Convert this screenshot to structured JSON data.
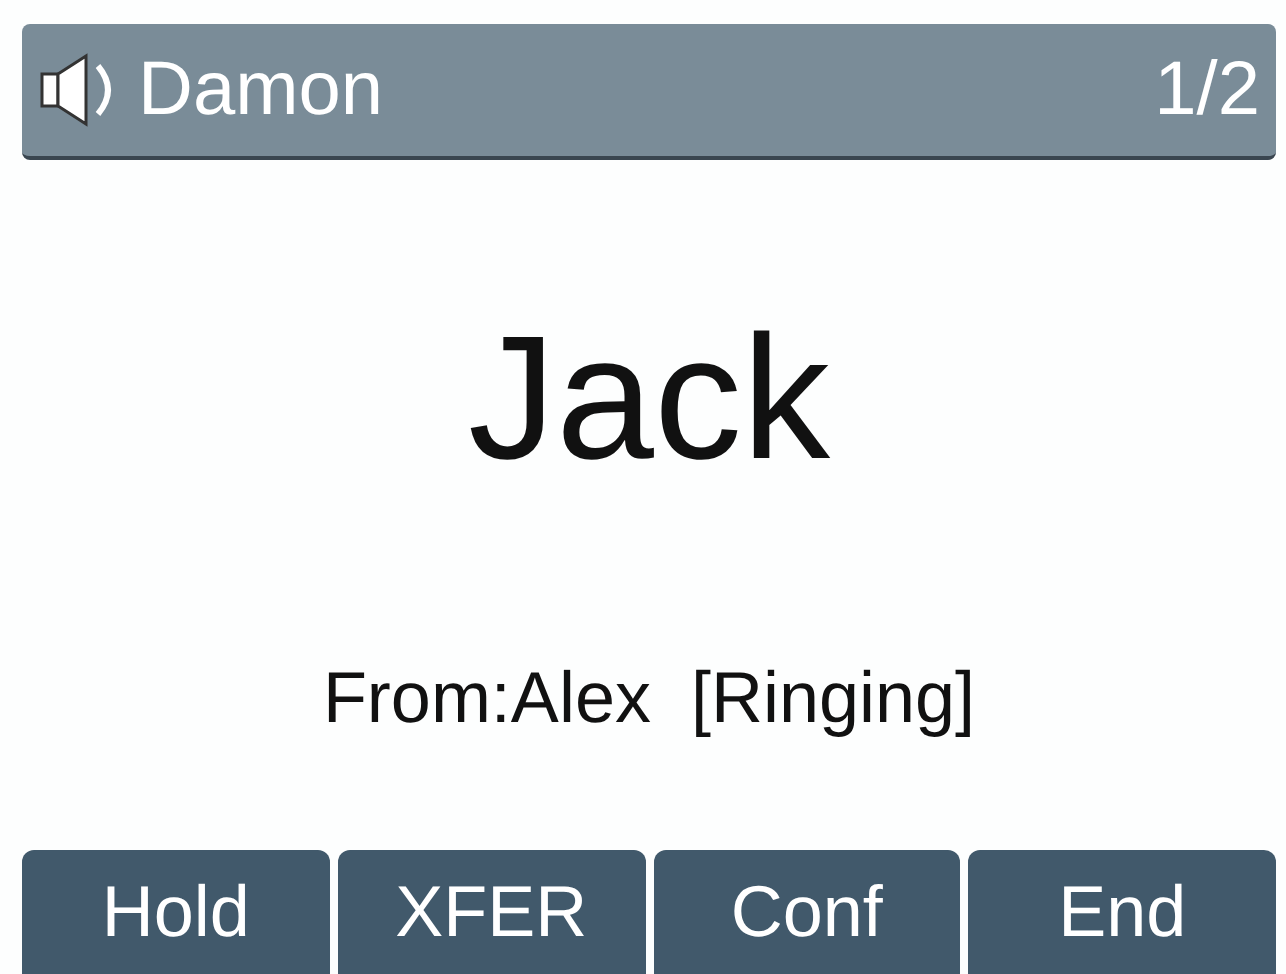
{
  "header": {
    "name": "Damon",
    "page": "1/2"
  },
  "call": {
    "name": "Jack",
    "from": "From:Alex",
    "status": "[Ringing]"
  },
  "softkeys": [
    "Hold",
    "XFER",
    "Conf",
    "End"
  ]
}
